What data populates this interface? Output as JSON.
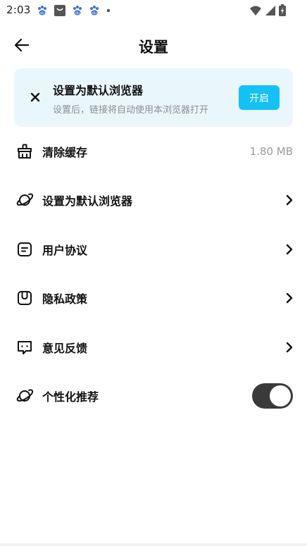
{
  "status_bar": {
    "time": "2:03",
    "left_icons": [
      "baidu-paw-icon",
      "shopping-bag-icon",
      "baidu-paw-icon",
      "baidu-paw-icon",
      "dot-icon"
    ],
    "right_icons": [
      "wifi-icon",
      "signal-icon",
      "battery-charging-icon"
    ]
  },
  "header": {
    "title": "设置",
    "back_icon": "arrow-left-icon"
  },
  "banner": {
    "title": "设置为默认浏览器",
    "description": "设置后，链接将自动使用本浏览器打开",
    "button_label": "开启",
    "close_icon": "close-icon",
    "background": "#e9f7fd",
    "button_color": "#14c1f4"
  },
  "settings": {
    "items": [
      {
        "icon": "broom-icon",
        "label": "清除缓存",
        "value": "1.80 MB"
      },
      {
        "icon": "planet-icon",
        "label": "设置为默认浏览器",
        "chevron": "chevron-right-icon"
      },
      {
        "icon": "agreement-icon",
        "label": "用户协议",
        "chevron": "chevron-right-icon"
      },
      {
        "icon": "privacy-icon",
        "label": "隐私政策",
        "chevron": "chevron-right-icon"
      },
      {
        "icon": "feedback-icon",
        "label": "意见反馈",
        "chevron": "chevron-right-icon"
      },
      {
        "icon": "planet-icon",
        "label": "个性化推荐",
        "toggle_on": true
      }
    ]
  }
}
